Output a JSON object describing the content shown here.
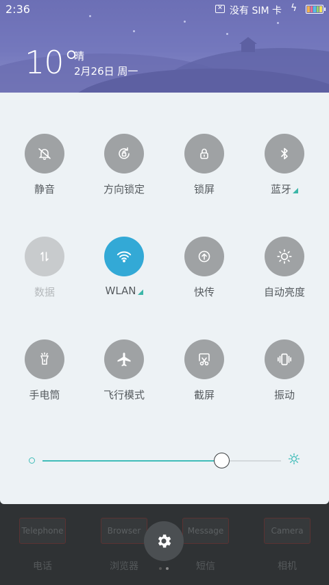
{
  "status": {
    "time": "2:36",
    "sim_text": "没有 SIM 卡",
    "icons": [
      "no-sim-icon",
      "charging-icon",
      "battery-icon"
    ]
  },
  "weather": {
    "temperature": "10°",
    "condition": "晴",
    "date": "2月26日 周一"
  },
  "toggles": [
    {
      "label": "静音",
      "icon": "bell-off-icon",
      "state": "off"
    },
    {
      "label": "方向锁定",
      "icon": "rotation-lock-icon",
      "state": "off"
    },
    {
      "label": "锁屏",
      "icon": "lock-icon",
      "state": "off"
    },
    {
      "label": "蓝牙",
      "icon": "bluetooth-icon",
      "state": "off",
      "has_submenu": true
    },
    {
      "label": "数据",
      "icon": "data-arrows-icon",
      "state": "disabled"
    },
    {
      "label": "WLAN",
      "icon": "wifi-icon",
      "state": "on",
      "has_submenu": true
    },
    {
      "label": "快传",
      "icon": "quick-transfer-icon",
      "state": "off"
    },
    {
      "label": "自动亮度",
      "icon": "auto-brightness-icon",
      "state": "off"
    },
    {
      "label": "手电筒",
      "icon": "flashlight-icon",
      "state": "off"
    },
    {
      "label": "飞行模式",
      "icon": "airplane-icon",
      "state": "off"
    },
    {
      "label": "截屏",
      "icon": "screenshot-icon",
      "state": "off"
    },
    {
      "label": "振动",
      "icon": "vibrate-icon",
      "state": "off"
    }
  ],
  "brightness": {
    "level_percent": 75
  },
  "home_apps": [
    {
      "box": "Telephone",
      "name": "电话"
    },
    {
      "box": "Browser",
      "name": "浏览器"
    },
    {
      "box": "Message",
      "name": "短信"
    },
    {
      "box": "Camera",
      "name": "相机"
    }
  ],
  "colors": {
    "accent": "#33a9d6",
    "slider": "#3fbcb8",
    "header": "#7478bd",
    "panel": "#edf2f5",
    "toggle_off": "#9fa2a4"
  }
}
